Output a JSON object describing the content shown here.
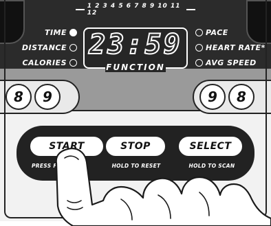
{
  "scale": {
    "text": "1 2 3 4 5 6 7 8 9 10 11 12"
  },
  "left_indicators": [
    {
      "label": "TIME",
      "active": true
    },
    {
      "label": "DISTANCE",
      "active": false
    },
    {
      "label": "CALORIES",
      "active": false
    }
  ],
  "right_indicators": [
    {
      "label": "PACE",
      "active": false
    },
    {
      "label": "HEART RATE*",
      "active": false
    },
    {
      "label": "AVG SPEED",
      "active": false
    }
  ],
  "display": {
    "digits": "23:59",
    "label": "FUNCTION"
  },
  "left_keys": [
    "8",
    "9"
  ],
  "right_keys": [
    "9",
    "8"
  ],
  "buttons": {
    "start": {
      "label": "START",
      "caption": "PRESS F… ART"
    },
    "stop": {
      "label": "STOP",
      "caption": "HOLD TO RESET"
    },
    "select": {
      "label": "SELECT",
      "caption": "HOLD TO SCAN"
    }
  }
}
